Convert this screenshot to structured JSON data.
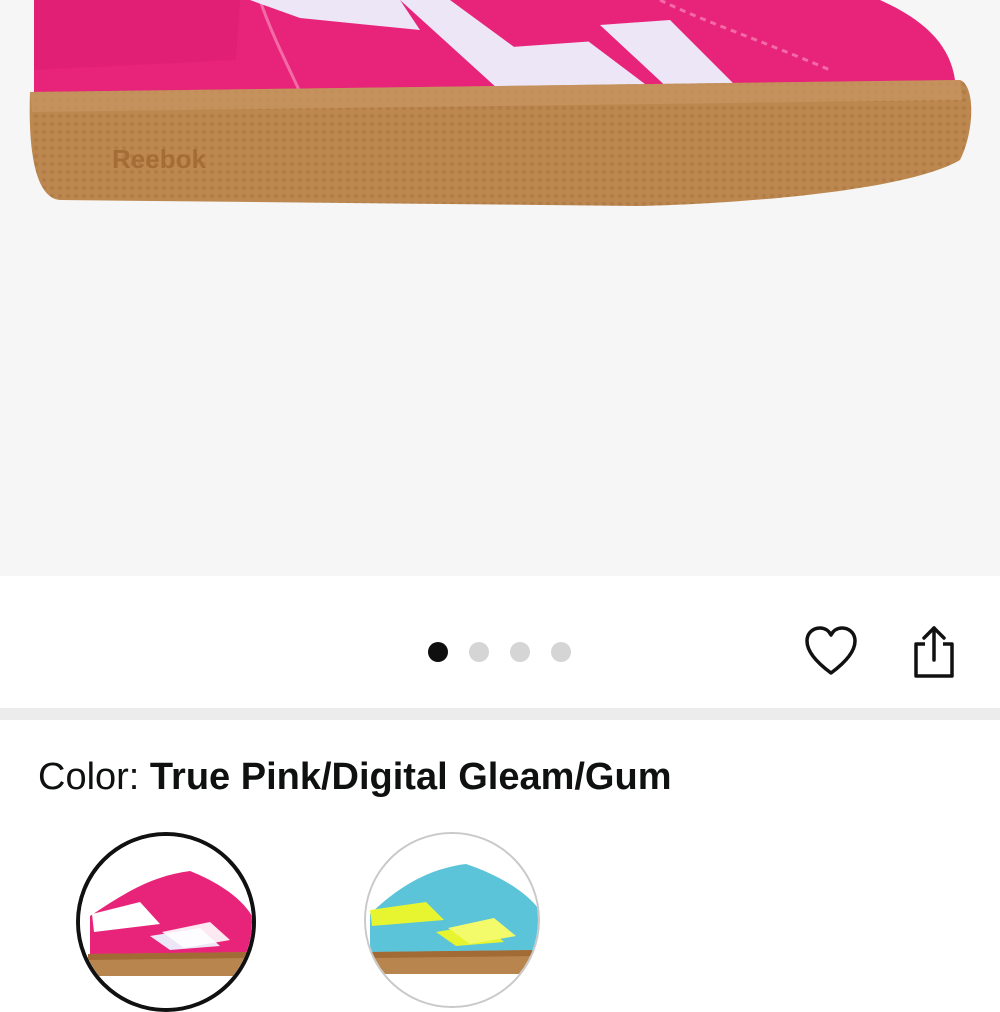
{
  "product_image": {
    "alt": "Pink suede sneaker with white stripes and gum sole",
    "brand_text": "Reebok"
  },
  "gallery": {
    "page_count": 4,
    "active_index": 0
  },
  "actions": {
    "heart_icon": "heart-icon",
    "share_icon": "share-icon"
  },
  "color": {
    "label": "Color: ",
    "value": "True Pink/Digital Gleam/Gum",
    "options": [
      {
        "name": "True Pink/Digital Gleam/Gum",
        "selected": true
      },
      {
        "name": "Blue/Neon Yellow/Gum",
        "selected": false
      }
    ]
  },
  "colors": {
    "pink": "#e8247a",
    "gum": "#b9854f",
    "stripe": "#ece6f7",
    "teal": "#5cc4d8",
    "neon": "#e6f530"
  }
}
